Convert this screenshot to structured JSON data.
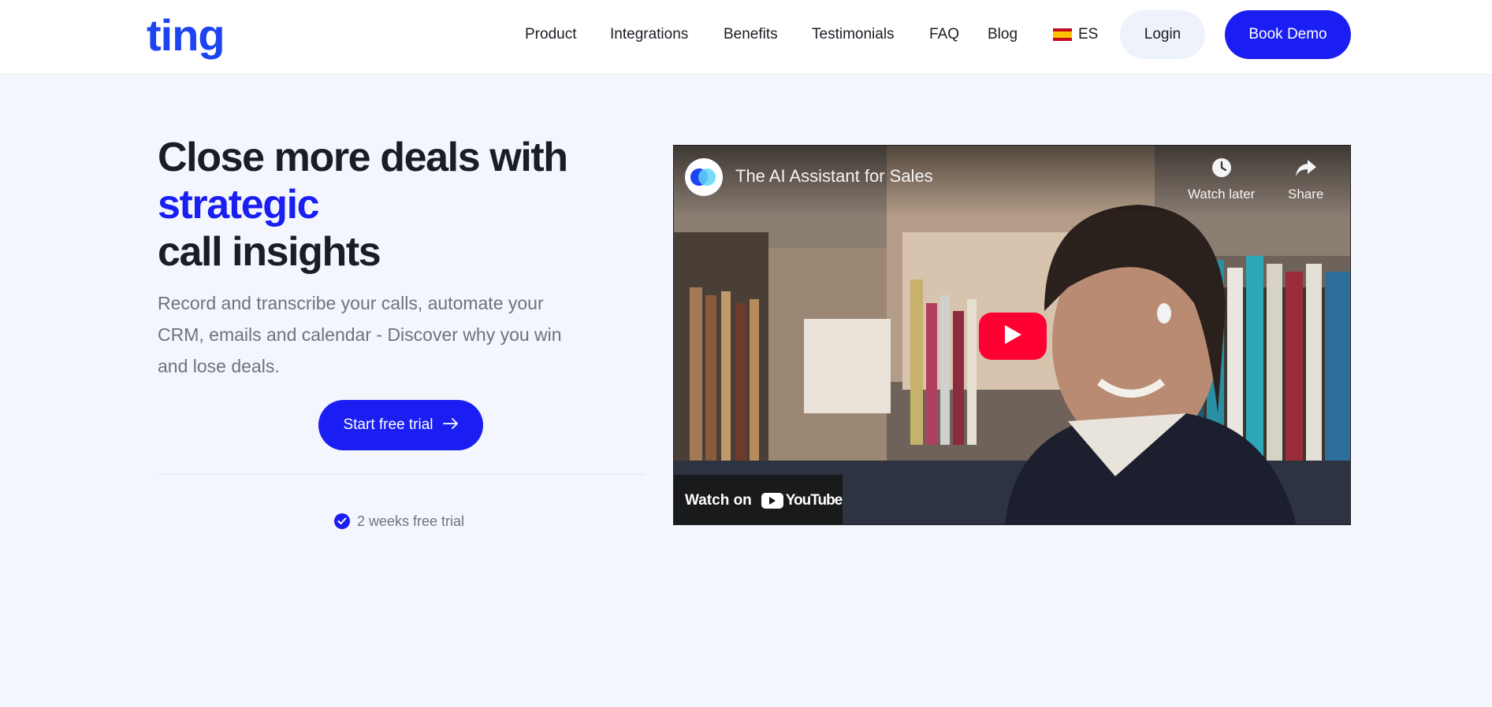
{
  "header": {
    "logo_text": "ting",
    "nav": [
      "Product",
      "Integrations",
      "Benefits",
      "Testimonials",
      "FAQ",
      "Blog"
    ],
    "language": "ES",
    "login_label": "Login",
    "book_label": "Book Demo"
  },
  "hero": {
    "headline_line1": "Close more deals with",
    "headline_accent": "strategic",
    "headline_line3": "call insights",
    "subtitle": "Record and transcribe your calls, automate your CRM, emails and calendar - Discover why you win and lose deals.",
    "cta_label": "Start free trial",
    "trial_note": "2 weeks free trial"
  },
  "video": {
    "title": "The AI Assistant for Sales",
    "watch_later": "Watch later",
    "share": "Share",
    "watch_on": "Watch on",
    "youtube": "YouTube"
  },
  "colors": {
    "brand_blue": "#1a1ef2",
    "logo_blue": "#1c44f0",
    "youtube_red": "#ff0033",
    "background": "#f3f6fd"
  }
}
